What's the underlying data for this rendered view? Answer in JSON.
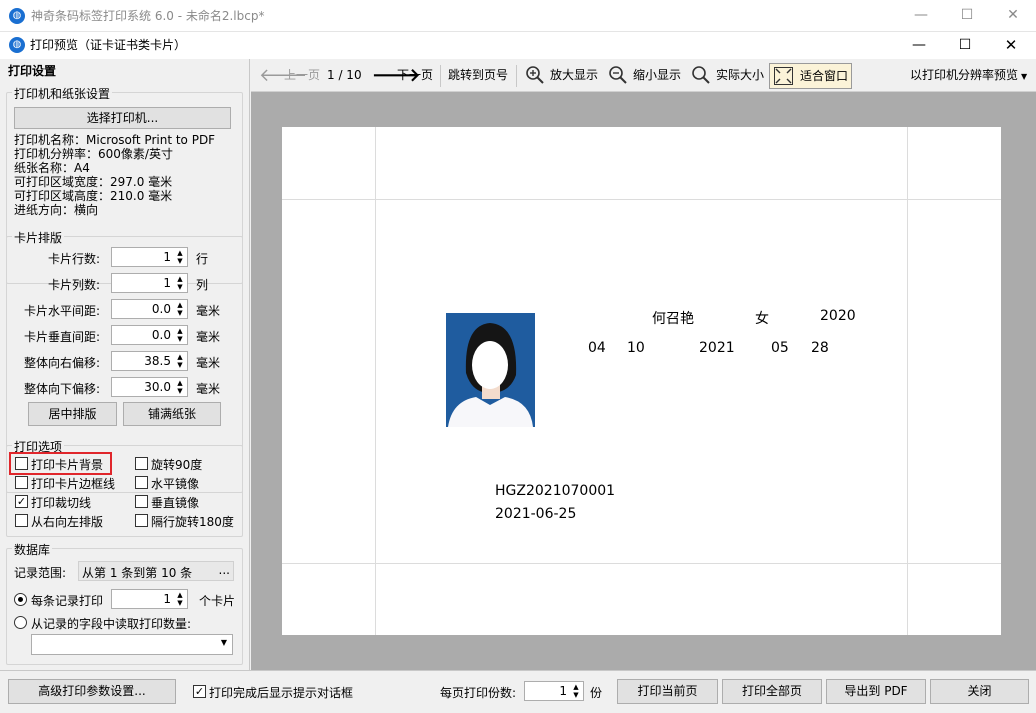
{
  "window": {
    "title": "神奇条码标签打印系统 6.0 - ",
    "doc_name": "未命名2.lbcp*",
    "icon": "app-globe-icon"
  },
  "dialog": {
    "title": "打印预览（证卡证书类卡片）"
  },
  "left": {
    "heading": "打印设置",
    "printer_group": {
      "label": "打印机和纸张设置",
      "select_button": "选择打印机...",
      "info": [
        "打印机名称：Microsoft Print to PDF",
        "打印机分辨率：600像素/英寸",
        "纸张名称：A4",
        "可打印区域宽度：297.0 毫米",
        "可打印区域高度：210.0 毫米",
        "进纸方向：横向"
      ]
    },
    "layout_group": {
      "label": "卡片排版",
      "rows": [
        {
          "label": "卡片行数:",
          "value": "1",
          "unit": "行"
        },
        {
          "label": "卡片列数:",
          "value": "1",
          "unit": "列"
        },
        {
          "label": "卡片水平间距:",
          "value": "0.0",
          "unit": "毫米"
        },
        {
          "label": "卡片垂直间距:",
          "value": "0.0",
          "unit": "毫米"
        },
        {
          "label": "整体向右偏移:",
          "value": "38.5",
          "unit": "毫米"
        },
        {
          "label": "整体向下偏移:",
          "value": "30.0",
          "unit": "毫米"
        }
      ],
      "center_button": "居中排版",
      "fill_button": "铺满纸张"
    },
    "options_group": {
      "label": "打印选项",
      "options": [
        {
          "label": "打印卡片背景",
          "checked": false
        },
        {
          "label": "旋转90度",
          "checked": false
        },
        {
          "label": "打印卡片边框线",
          "checked": false
        },
        {
          "label": "水平镜像",
          "checked": false
        },
        {
          "label": "打印裁切线",
          "checked": true
        },
        {
          "label": "垂直镜像",
          "checked": false
        },
        {
          "label": "从右向左排版",
          "checked": false
        },
        {
          "label": "隔行旋转180度",
          "checked": false
        }
      ]
    },
    "db_group": {
      "label": "数据库",
      "range_label": "记录范围:",
      "range_value": "从第 1 条到第 10 条",
      "range_button": "...",
      "per_record_label": "每条记录打印",
      "per_record_value": "1",
      "per_record_unit": "个卡片",
      "from_field_label": "从记录的字段中读取打印数量:"
    }
  },
  "toolbar": {
    "prev": "上一页",
    "page_indicator": "1 / 10",
    "next": "下一页",
    "jump": "跳转到页号",
    "zoom_in": "放大显示",
    "zoom_out": "缩小显示",
    "actual": "实际大小",
    "fit": "适合窗口",
    "resolution": "以打印机分辨率预览"
  },
  "card": {
    "name": "何召艳",
    "gender": "女",
    "year1": "2020",
    "month1": "04",
    "day1": "10",
    "year2": "2021",
    "month2": "05",
    "day2": "28",
    "code": "HGZ2021070001",
    "date": "2021-06-25"
  },
  "bottom": {
    "advanced": "高级打印参数设置...",
    "show_dialog": "打印完成后显示提示对话框",
    "copies_label": "每页打印份数:",
    "copies_value": "1",
    "copies_unit": "份",
    "print_current": "打印当前页",
    "print_all": "打印全部页",
    "export_pdf": "导出到 PDF",
    "close": "关闭"
  }
}
